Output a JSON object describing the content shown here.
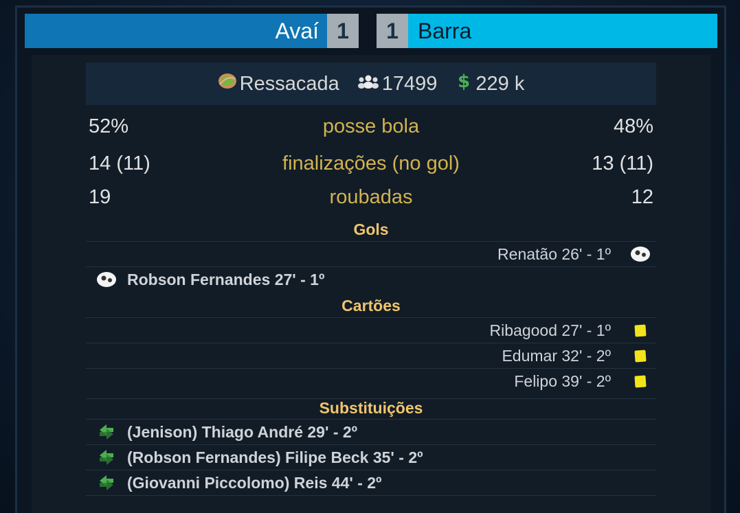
{
  "match": {
    "home_team": "Avaí",
    "home_score": "1",
    "away_score": "1",
    "away_team": "Barra"
  },
  "venue": {
    "stadium": "Ressacada",
    "attendance": "17499",
    "income": "229 k"
  },
  "stats": [
    {
      "label": "posse bola",
      "home": "52%",
      "away": "48%"
    },
    {
      "label": "finalizações (no gol)",
      "home": "14 (11)",
      "away": "13 (11)"
    },
    {
      "label": "roubadas",
      "home": "19",
      "away": "12"
    }
  ],
  "sections": {
    "goals": "Gols",
    "cards": "Cartões",
    "subs": "Substituições"
  },
  "goals": [
    {
      "side": "away",
      "text": "Renatão 26' - 1º"
    },
    {
      "side": "home",
      "text": "Robson Fernandes 27' - 1º"
    }
  ],
  "cards": [
    {
      "side": "away",
      "text": "Ribagood 27' - 1º",
      "color": "yellow"
    },
    {
      "side": "away",
      "text": "Edumar 32' - 2º",
      "color": "yellow"
    },
    {
      "side": "away",
      "text": "Felipo 39' - 2º",
      "color": "yellow"
    }
  ],
  "subs": [
    {
      "side": "home",
      "text": "(Jenison) Thiago André 29' - 2º"
    },
    {
      "side": "home",
      "text": "(Robson Fernandes) Filipe Beck 35' - 2º"
    },
    {
      "side": "home",
      "text": "(Giovanni Piccolomo) Reis 44' - 2º"
    }
  ],
  "colors": {
    "home_bar": "#0f75b4",
    "away_bar": "#00b8e6",
    "score_box": "#a4acb4",
    "label_gold": "#d4b34e",
    "section_gold": "#f0c56c",
    "yellow_card": "#f3e41a"
  },
  "icons": {
    "stadium": "stadium-icon",
    "attendance": "crowd-icon",
    "income": "money-icon",
    "goal": "soccer-ball-icon",
    "card": "yellow-card-icon",
    "sub": "substitution-icon"
  }
}
